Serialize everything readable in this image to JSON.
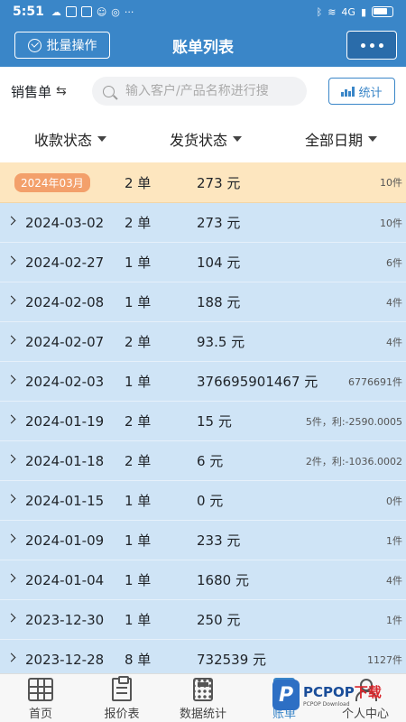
{
  "status": {
    "time": "5:51",
    "left_icons": [
      "☁",
      "B",
      "C",
      "☺",
      "◎",
      "···"
    ],
    "network": "4G",
    "accent": "#3a86c8"
  },
  "header": {
    "batch_label": "批量操作",
    "title": "账单列表",
    "more_icon": "more-dots-icon"
  },
  "search": {
    "type_label": "销售单",
    "placeholder": "输入客户/产品名称进行搜",
    "stats_label": "统计"
  },
  "filters": {
    "payment": "收款状态",
    "shipping": "发货状态",
    "date": "全部日期"
  },
  "month_group": {
    "label": "2024年03月",
    "count": "2 单",
    "amount": "273 元",
    "extra": "10件"
  },
  "rows": [
    {
      "date": "2024-03-02",
      "count": "2 单",
      "amount": "273 元",
      "extra": "10件"
    },
    {
      "date": "2024-02-27",
      "count": "1 单",
      "amount": "104 元",
      "extra": "6件"
    },
    {
      "date": "2024-02-08",
      "count": "1 单",
      "amount": "188 元",
      "extra": "4件"
    },
    {
      "date": "2024-02-07",
      "count": "2 单",
      "amount": "93.5 元",
      "extra": "4件"
    },
    {
      "date": "2024-02-03",
      "count": "1 单",
      "amount": "376695901467 元",
      "extra": "6776691件"
    },
    {
      "date": "2024-01-19",
      "count": "2 单",
      "amount": "15 元",
      "extra": "5件，利:-2590.0005"
    },
    {
      "date": "2024-01-18",
      "count": "2 单",
      "amount": "6 元",
      "extra": "2件，利:-1036.0002"
    },
    {
      "date": "2024-01-15",
      "count": "1 单",
      "amount": "0 元",
      "extra": "0件"
    },
    {
      "date": "2024-01-09",
      "count": "1 单",
      "amount": "233 元",
      "extra": "1件"
    },
    {
      "date": "2024-01-04",
      "count": "1 单",
      "amount": "1680 元",
      "extra": "4件"
    },
    {
      "date": "2023-12-30",
      "count": "1 单",
      "amount": "250 元",
      "extra": "1件"
    },
    {
      "date": "2023-12-28",
      "count": "8 单",
      "amount": "732539 元",
      "extra": "1127件"
    }
  ],
  "nav": [
    {
      "label": "首页",
      "icon": "grid-icon"
    },
    {
      "label": "报价表",
      "icon": "clipboard-icon"
    },
    {
      "label": "数据统计",
      "icon": "calculator-icon"
    },
    {
      "label": "账单",
      "icon": "bill-icon"
    },
    {
      "label": "个人中心",
      "icon": "person-icon"
    }
  ],
  "watermark": {
    "letter": "P",
    "brand_a": "PCPOP",
    "brand_b": "下载",
    "sub": "PCPOP Download"
  }
}
